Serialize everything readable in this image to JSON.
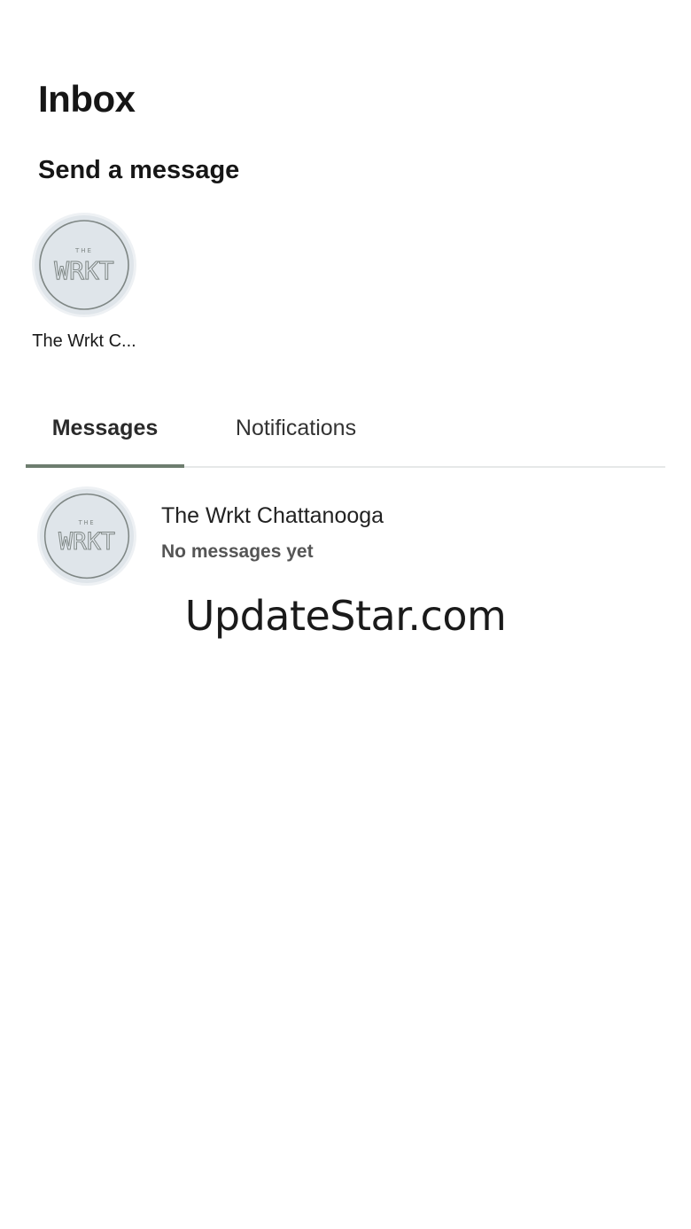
{
  "header": {
    "title": "Inbox"
  },
  "send_section": {
    "title": "Send a message",
    "contacts": [
      {
        "name": "The Wrkt C...",
        "logo_top": "THE",
        "logo_main": "WRKT"
      }
    ]
  },
  "tabs": [
    {
      "label": "Messages",
      "active": true
    },
    {
      "label": "Notifications",
      "active": false
    }
  ],
  "conversations": [
    {
      "name": "The Wrkt Chattanooga",
      "preview": "No messages yet",
      "logo_top": "THE",
      "logo_main": "WRKT"
    }
  ],
  "watermark": "UpdateStar.com",
  "colors": {
    "tab_indicator": "#6d7d6e",
    "avatar_bg": "#dfe5ea",
    "logo_ink": "#7e8684"
  }
}
